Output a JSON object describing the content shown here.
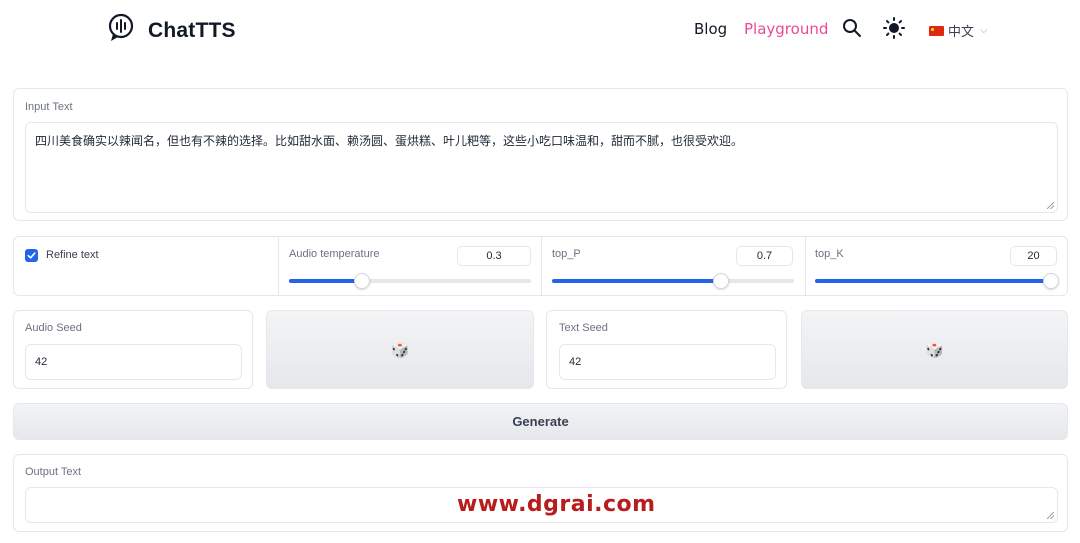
{
  "header": {
    "brand": "ChatTTS",
    "nav": {
      "blog": "Blog",
      "playground": "Playground"
    },
    "language": "中文",
    "accent_color": "#ec4899",
    "icons": [
      "logo-icon",
      "search-icon",
      "sun-icon",
      "flag-icon",
      "chevron-down-icon"
    ]
  },
  "input_text": {
    "label": "Input Text",
    "value": "四川美食确实以辣闻名，但也有不辣的选择。比如甜水面、赖汤圆、蛋烘糕、叶儿粑等，这些小吃口味温和，甜而不腻，也很受欢迎。"
  },
  "params": {
    "refine_label": "Refine text",
    "refine_checked": true,
    "audio_temperature": {
      "label": "Audio temperature",
      "value": "0.3",
      "min": 0,
      "max": 1,
      "fraction": 0.3
    },
    "top_p": {
      "label": "top_P",
      "value": "0.7",
      "min": 0,
      "max": 1,
      "fraction": 0.7
    },
    "top_k": {
      "label": "top_K",
      "value": "20",
      "min": 1,
      "max": 20,
      "fraction": 1.0
    }
  },
  "seeds": {
    "audio_label": "Audio Seed",
    "audio_value": "42",
    "text_label": "Text Seed",
    "text_value": "42",
    "dice": "🎲"
  },
  "generate_label": "Generate",
  "output_text": {
    "label": "Output Text",
    "value": ""
  },
  "watermark": "www.dgrai.com",
  "slider_color": "#2563eb"
}
